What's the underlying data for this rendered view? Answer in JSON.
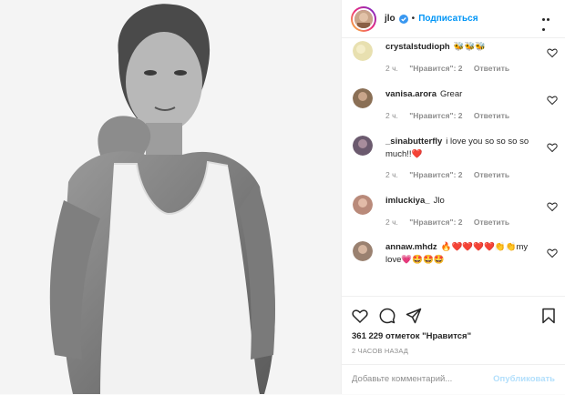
{
  "header": {
    "username": "jlo",
    "dot": "•",
    "follow_label": "Подписаться",
    "verified_icon": "verified-badge-icon",
    "more_icon": "more-options-icon"
  },
  "comments": [
    {
      "user": "crystalstudioph",
      "text": "🐝🐝🐝",
      "age": "2 ч.",
      "likes": "\"Нравится\": 2",
      "reply": "Ответить",
      "avatar_color": "#e8e0b0"
    },
    {
      "user": "vanisa.arora",
      "text": "Grear",
      "age": "2 ч.",
      "likes": "\"Нравится\": 2",
      "reply": "Ответить",
      "avatar_color": "#8a6f55"
    },
    {
      "user": "_sinabutterfly",
      "text": "i love you so so so so much!!❤️",
      "age": "2 ч.",
      "likes": "\"Нравится\": 2",
      "reply": "Ответить",
      "avatar_color": "#6b5a6e"
    },
    {
      "user": "imluckiya_",
      "text": "Jlo",
      "age": "2 ч.",
      "likes": "\"Нравится\": 2",
      "reply": "Ответить",
      "avatar_color": "#b98a7a"
    },
    {
      "user": "annaw.mhdz",
      "text": "🔥❤️❤️❤️❤️👏👏my love💗🤩🤩🤩",
      "age": "2 ч.",
      "likes": "\"Нравится\": 2",
      "reply": "Ответить",
      "avatar_color": "#9a8170"
    }
  ],
  "actions": {
    "likes_text": "361 229 отметок \"Нравится\"",
    "time_text": "2 ЧАСОВ НАЗАД",
    "comment_placeholder": "Добавьте комментарий...",
    "publish_label": "Опубликовать"
  },
  "colors": {
    "link": "#0095f6",
    "publish_disabled": "#b2dffc",
    "meta": "#8e8e8e"
  }
}
